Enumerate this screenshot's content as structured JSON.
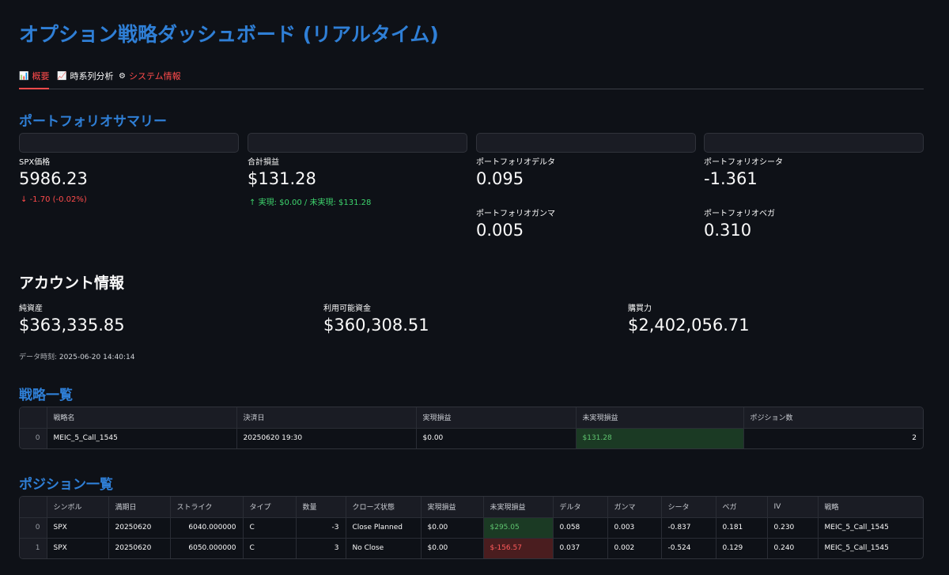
{
  "app": {
    "title": "オプション戦略ダッシュボード (リアルタイム)"
  },
  "tabs": [
    {
      "label": "概要",
      "icon": "📊"
    },
    {
      "label": "時系列分析",
      "icon": "📈"
    },
    {
      "label": "システム情報",
      "icon": "⚙"
    }
  ],
  "portfolio": {
    "heading": "ポートフォリオサマリー",
    "spx": {
      "label": "SPX価格",
      "value": "5986.23",
      "delta": "-1.70 (-0.02%)",
      "arrow": "↓"
    },
    "pnl": {
      "label": "合計損益",
      "value": "$131.28",
      "delta": "実現: $0.00 / 未実現: $131.28",
      "arrow": "↑"
    },
    "delta": {
      "label": "ポートフォリオデルタ",
      "value": "0.095"
    },
    "gamma": {
      "label": "ポートフォリオガンマ",
      "value": "0.005"
    },
    "theta": {
      "label": "ポートフォリオシータ",
      "value": "-1.361"
    },
    "vega": {
      "label": "ポートフォリオベガ",
      "value": "0.310"
    }
  },
  "account": {
    "heading": "アカウント情報",
    "net_assets": {
      "label": "純資産",
      "value": "$363,335.85"
    },
    "available_funds": {
      "label": "利用可能資金",
      "value": "$360,308.51"
    },
    "buying_power": {
      "label": "購買力",
      "value": "$2,402,056.71"
    },
    "timestamp_label": "データ時刻:",
    "timestamp_value": "2025-06-20 14:40:14"
  },
  "strategies": {
    "heading": "戦略一覧",
    "columns": [
      "",
      "戦略名",
      "決済日",
      "実現損益",
      "未実現損益",
      "ポジション数"
    ],
    "rows": [
      [
        "0",
        "MEIC_5_Call_1545",
        "20250620 19:30",
        "$0.00",
        "$131.28",
        "2"
      ]
    ]
  },
  "positions": {
    "heading": "ポジション一覧",
    "columns": [
      "",
      "シンボル",
      "満期日",
      "ストライク",
      "タイプ",
      "数量",
      "クローズ状態",
      "実現損益",
      "未実現損益",
      "デルタ",
      "ガンマ",
      "シータ",
      "ベガ",
      "IV",
      "戦略"
    ],
    "rows": [
      [
        "0",
        "SPX",
        "20250620",
        "6040.000000",
        "C",
        "-3",
        "Close Planned",
        "$0.00",
        "$295.05",
        "0.058",
        "0.003",
        "-0.837",
        "0.181",
        "0.230",
        "MEIC_5_Call_1545"
      ],
      [
        "1",
        "SPX",
        "20250620",
        "6050.000000",
        "C",
        "3",
        "No Close",
        "$0.00",
        "$-156.57",
        "0.037",
        "0.002",
        "-0.524",
        "0.129",
        "0.240",
        "MEIC_5_Call_1545"
      ]
    ]
  },
  "colors": {
    "accent": "#2f7fd6",
    "active_tab": "#ff4b4b",
    "positive": "#3dd56d",
    "negative": "#ff4b4b",
    "background": "#0e1117"
  }
}
